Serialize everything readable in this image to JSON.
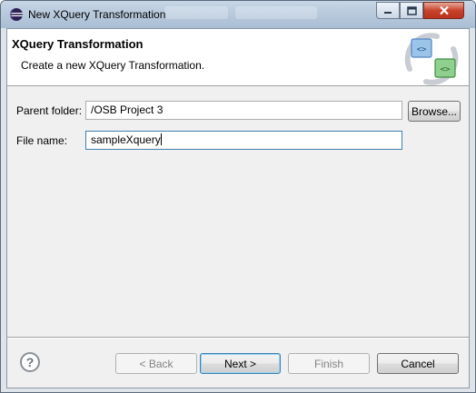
{
  "window": {
    "title": "New XQuery Transformation",
    "app_icon": "eclipse-icon"
  },
  "banner": {
    "title": "XQuery Transformation",
    "description": "Create a new XQuery Transformation.",
    "art_icon": "xquery-transform-icon",
    "art_glyph_left": "<>",
    "art_glyph_right": "<>"
  },
  "form": {
    "parent_folder_label": "Parent folder:",
    "parent_folder_value": "/OSB Project 3",
    "browse_label": "Browse...",
    "file_name_label": "File name:",
    "file_name_value": "sampleXquery"
  },
  "footer": {
    "help_glyph": "?",
    "back_label": "< Back",
    "next_label": "Next >",
    "finish_label": "Finish",
    "cancel_label": "Cancel"
  },
  "colors": {
    "titlebar": "#b9cadd",
    "dialog_bg": "#f0f0f0",
    "close_button": "#c8432c",
    "focus_border": "#3c7fb1"
  }
}
